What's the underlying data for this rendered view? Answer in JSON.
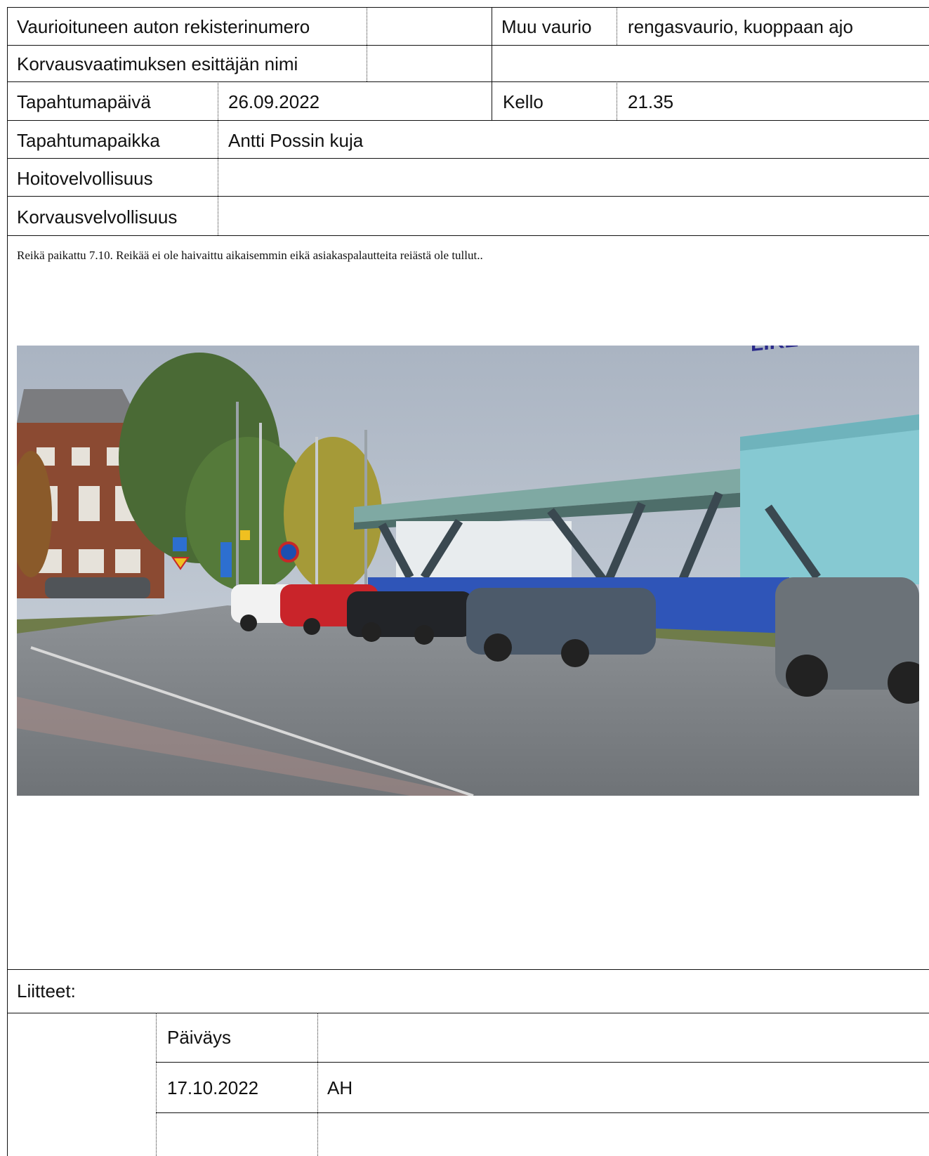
{
  "form": {
    "reg_label": "Vaurioituneen auton rekisterinumero",
    "reg_value": "",
    "other_damage_label": "Muu vaurio",
    "other_damage_value": "rengasvaurio, kuoppaan ajo",
    "claimant_label": "Korvausvaatimuksen esittäjän nimi",
    "claimant_value": "",
    "date_label": "Tapahtumapäivä",
    "date_value": "26.09.2022",
    "time_label": "Kello",
    "time_value": "21.35",
    "place_label": "Tapahtumapaikka",
    "place_value": "Antti Possin kuja",
    "maintenance_label": "Hoitovelvollisuus",
    "maintenance_value": "",
    "liability_label": "Korvausvelvollisuus",
    "liability_value": ""
  },
  "note": "Reikä paikattu 7.10. Reikää ei ole haivaittu aikaisemmin eikä asiakaspalautteita reiästä ole tullut..",
  "photo": {
    "sign_text": "LIKE"
  },
  "attachments": {
    "label": "Liitteet:",
    "date_header": "Päiväys",
    "date_value": "17.10.2022",
    "signer": "AH"
  }
}
